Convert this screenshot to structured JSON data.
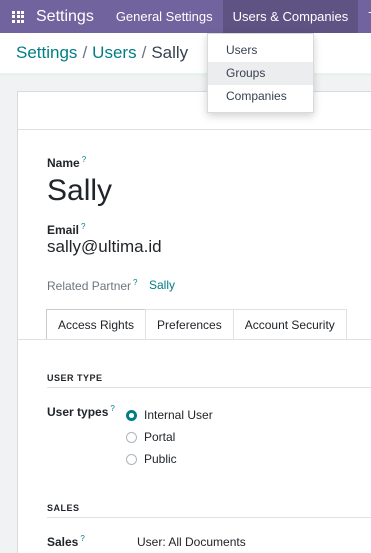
{
  "navbar": {
    "app_title": "Settings",
    "menu": [
      "General Settings",
      "Users & Companies",
      "Transla"
    ]
  },
  "breadcrumb": {
    "items": [
      "Settings",
      "Users",
      "Sally"
    ]
  },
  "dropdown": {
    "items": [
      "Users",
      "Groups",
      "Companies"
    ]
  },
  "form": {
    "name_label": "Name",
    "name_value": "Sally",
    "email_label": "Email",
    "email_value": "sally@ultima.id",
    "related_partner_label": "Related Partner",
    "related_partner_value": "Sally",
    "help_mark": "?"
  },
  "tabs": [
    "Access Rights",
    "Preferences",
    "Account Security"
  ],
  "user_type": {
    "section_title": "USER TYPE",
    "label": "User types",
    "options": [
      "Internal User",
      "Portal",
      "Public"
    ],
    "selected": "Internal User"
  },
  "sales": {
    "section_title": "SALES",
    "label": "Sales",
    "value": "User: All Documents"
  },
  "colors": {
    "navbar": "#71639e",
    "accent": "#017e84"
  }
}
